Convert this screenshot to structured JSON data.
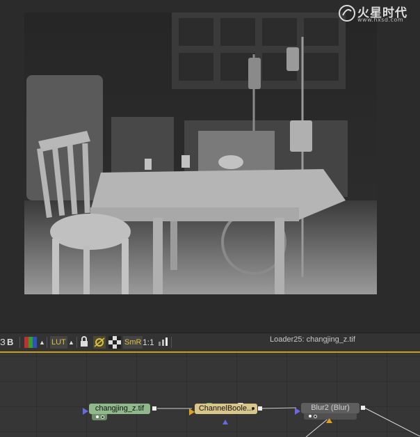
{
  "watermark": {
    "title": "火星时代",
    "url": "www.hxsd.com"
  },
  "toolbar": {
    "bold_label": "B",
    "lut_label": "LUT",
    "smr_label": "SmR",
    "ratio_label": "1:1",
    "status": "Loader25: changjing_z.tif"
  },
  "flow": {
    "nodes": [
      {
        "label": "changjing_z.tif",
        "color": "#8fb98a"
      },
      {
        "label": "ChannelBoole...",
        "color": "#d8c68a"
      },
      {
        "label": "Blur2  (Blur)",
        "color": "#5e5e5e"
      }
    ]
  },
  "colors": {
    "accent": "#c8a020",
    "background": "#2a2a2a"
  }
}
